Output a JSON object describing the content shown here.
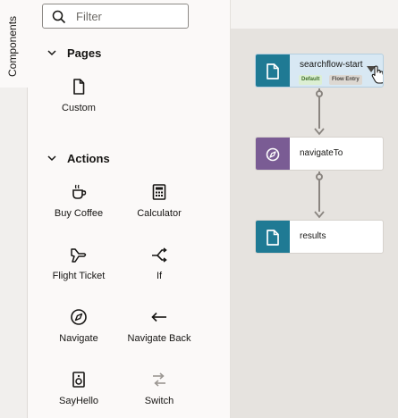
{
  "tabs": {
    "components": "Components"
  },
  "search": {
    "placeholder": "Filter"
  },
  "sections": {
    "pages": {
      "title": "Pages"
    },
    "actions": {
      "title": "Actions"
    }
  },
  "pages": [
    {
      "label": "Custom",
      "icon": "page-icon"
    }
  ],
  "actions": [
    {
      "label": "Buy Coffee",
      "icon": "coffee-cup-icon"
    },
    {
      "label": "Calculator",
      "icon": "calculator-icon"
    },
    {
      "label": "Flight Ticket",
      "icon": "airplane-icon"
    },
    {
      "label": "If",
      "icon": "branch-icon"
    },
    {
      "label": "Navigate",
      "icon": "compass-icon"
    },
    {
      "label": "Navigate Back",
      "icon": "arrow-left-icon"
    },
    {
      "label": "SayHello",
      "icon": "speaker-icon"
    },
    {
      "label": "Switch",
      "icon": "switch-icon"
    }
  ],
  "flow": {
    "nodes": [
      {
        "name": "searchflow-start",
        "badges": [
          "Default",
          "Flow Entry"
        ],
        "color": "#1f7a94",
        "icon": "page-icon",
        "selected": true
      },
      {
        "name": "navigateTo",
        "color": "#7a5c94",
        "icon": "compass-icon",
        "selected": false
      },
      {
        "name": "results",
        "color": "#1f7a94",
        "icon": "page-icon",
        "selected": false
      }
    ]
  }
}
